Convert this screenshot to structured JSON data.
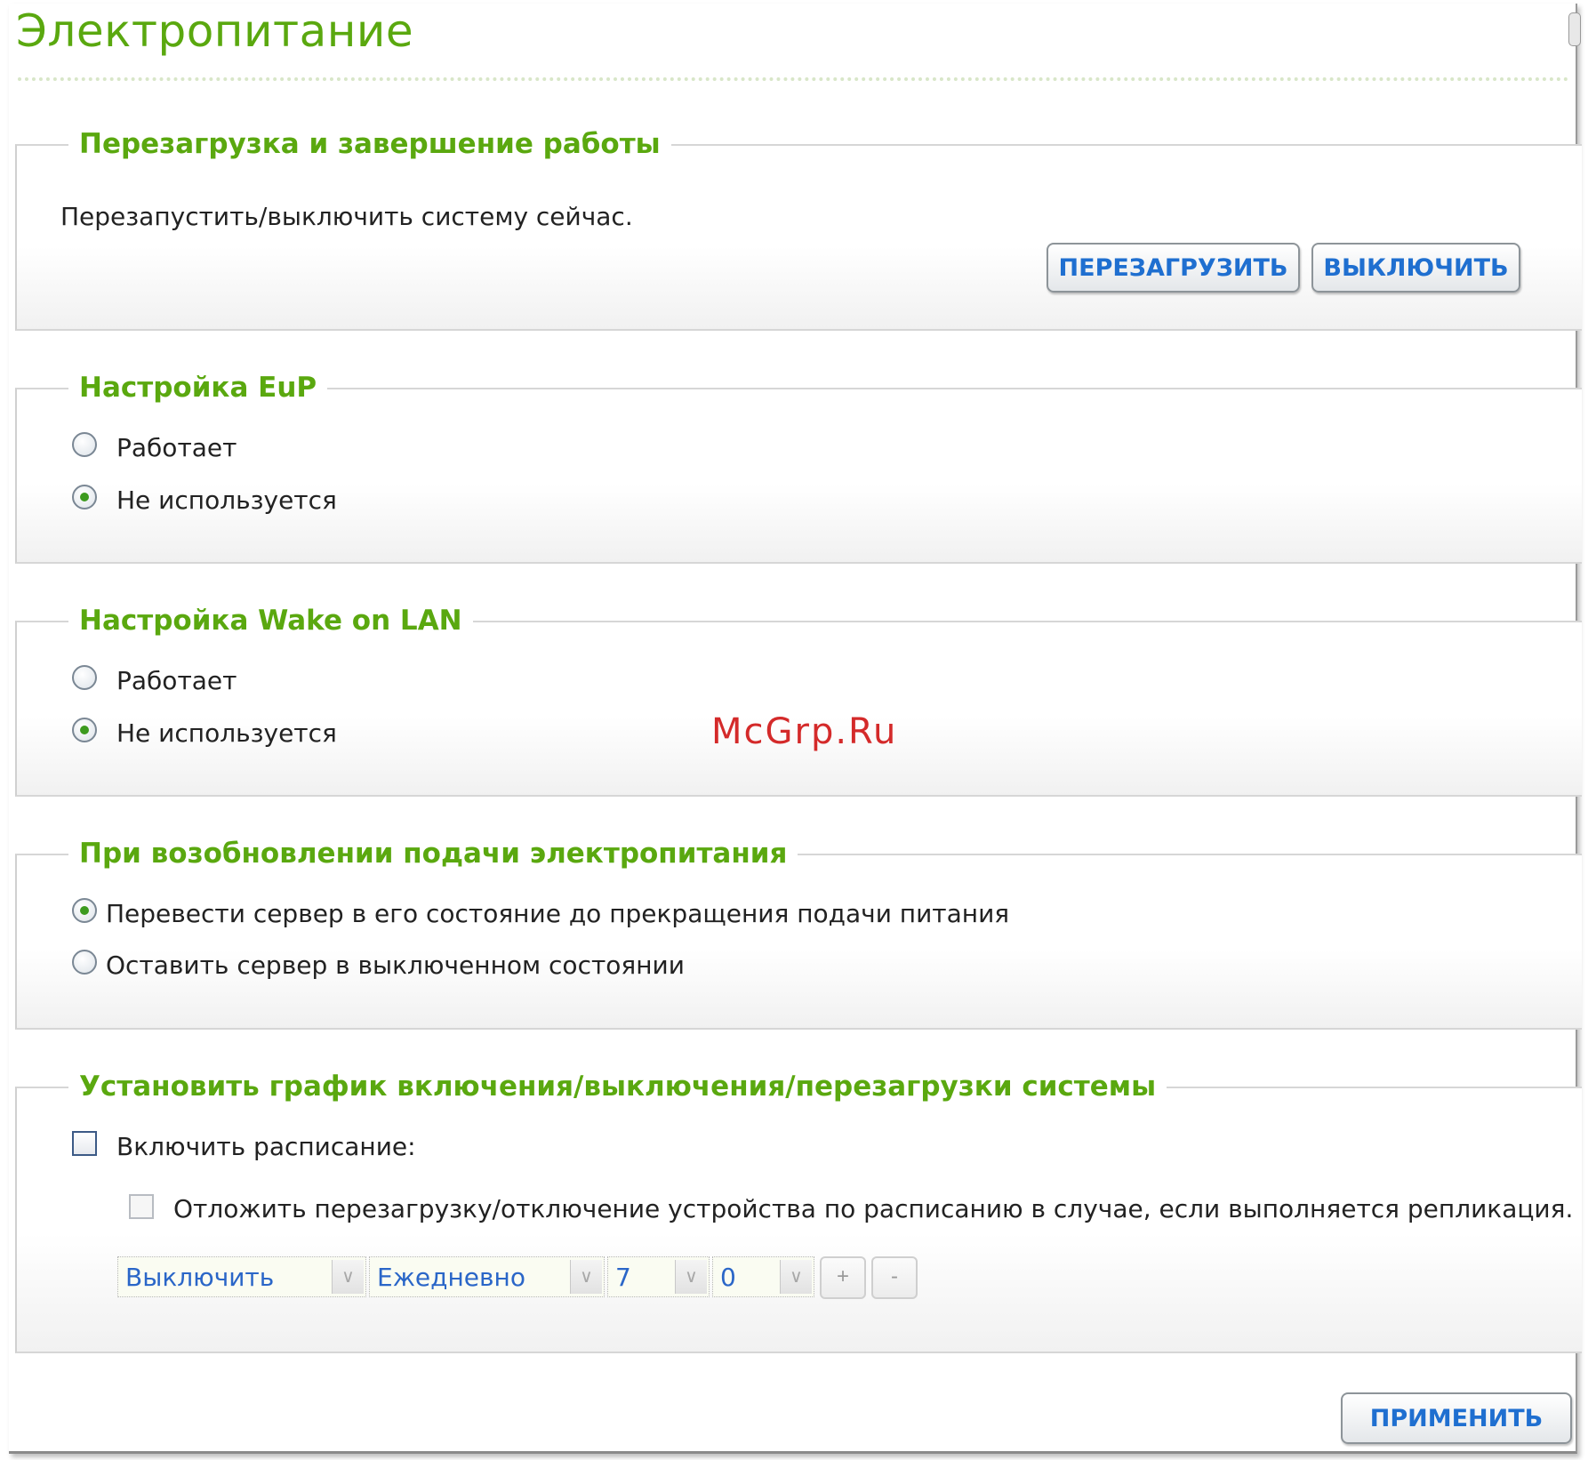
{
  "page": {
    "title": "Электропитание"
  },
  "restart_section": {
    "legend": "Перезагрузка и завершение работы",
    "description": "Перезапустить/выключить систему сейчас.",
    "restart_label": "ПЕРЕЗАГРУЗИТЬ",
    "shutdown_label": "ВЫКЛЮЧИТЬ"
  },
  "eup_section": {
    "legend": "Настройка EuP",
    "options": [
      {
        "label": "Работает",
        "checked": false
      },
      {
        "label": "Не используется",
        "checked": true
      }
    ]
  },
  "wol_section": {
    "legend": "Настройка Wake on LAN",
    "options": [
      {
        "label": "Работает",
        "checked": false
      },
      {
        "label": "Не используется",
        "checked": true
      }
    ]
  },
  "power_recovery_section": {
    "legend": "При возобновлении подачи электропитания",
    "options": [
      {
        "label": "Перевести сервер в его состояние до прекращения подачи питания",
        "checked": true
      },
      {
        "label": "Оставить сервер в выключенном состоянии",
        "checked": false
      }
    ]
  },
  "schedule_section": {
    "legend": "Установить график включения/выключения/перезагрузки системы",
    "enable_label": "Включить расписание:",
    "postpone_label": "Отложить перезагрузку/отключение устройства по расписанию в случае, если выполняется репликация.",
    "action_value": "Выключить",
    "frequency_value": "Ежедневно",
    "hour_value": "7",
    "minute_value": "0",
    "add_label": "+",
    "remove_label": "-"
  },
  "footer": {
    "apply_label": "ПРИМЕНИТЬ"
  },
  "watermark": "McGrp.Ru",
  "colors": {
    "accent_green": "#5aa80f",
    "button_text_blue": "#1f6fd0",
    "radio_dot": "#3c9a1e"
  },
  "icons": {
    "select_arrow": "chevron-down-icon"
  }
}
